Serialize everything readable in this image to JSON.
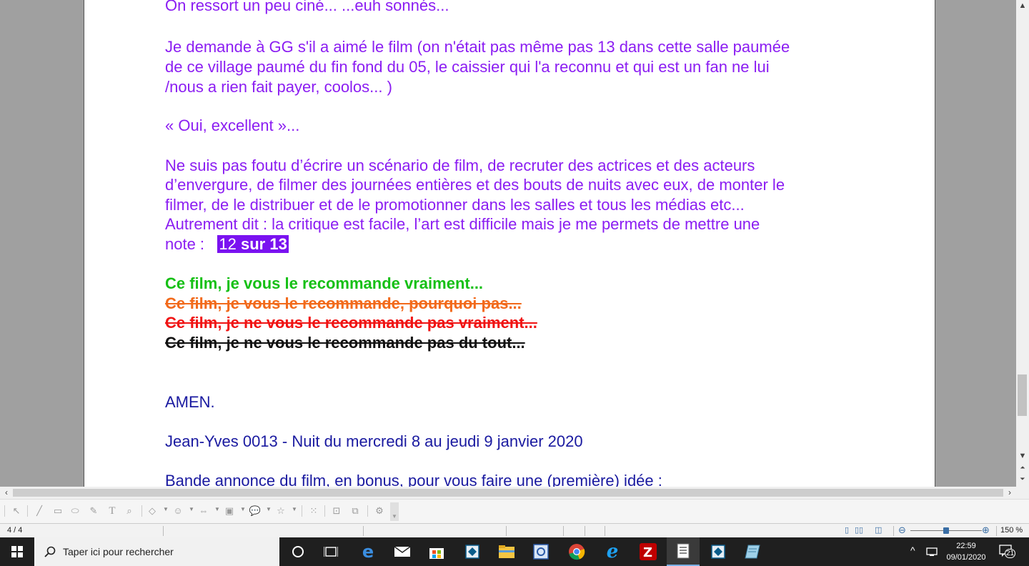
{
  "document": {
    "paragraphs": [
      "On ressort un peu ciné... ...euh sonnés...",
      "Je demande à GG s'il a aimé le film (on n'était pas même pas 13 dans cette salle paumée",
      "de ce village paumé du fin fond du 05, le caissier qui l'a reconnu et qui est un fan ne lui",
      "/nous a rien fait payer, coolos... )",
      "« Oui, excellent »...",
      "Ne suis pas foutu d’écrire un scénario de film, de recruter des actrices et des acteurs",
      "d’envergure, de filmer des journées entières et des bouts de nuits avec eux, de monter le",
      "filmer, de le distribuer et de le promotionner dans les salles et tous les médias etc...",
      "Autrement dit : la critique est facile, l’art est difficile mais je me permets de mettre une"
    ],
    "note_prefix": "note :",
    "note_value": "12",
    "note_rest": " sur 13",
    "recommendations": [
      "Ce film, je vous le recommande vraiment...",
      "Ce film, je vous le recommande, pourquoi  pas...",
      "Ce film, je ne vous le recommande pas vraiment...",
      "Ce film, je ne vous le recommande pas du tout..."
    ],
    "amen": "AMEN.",
    "signature": "Jean-Yves 0013  -  Nuit du mercredi 8 au jeudi 9 janvier 2020",
    "trailer": "Bande annonce du film, en bonus, pour vous faire une (première) idée  :"
  },
  "colors": {
    "violet_text": "#8b1df2",
    "navy_text": "#1a1aa0",
    "highlight": "#7a12f0",
    "green": "#16c016",
    "orange": "#f26a1b",
    "red": "#f01313"
  },
  "statusbar": {
    "page_indicator": "4 / 4",
    "zoom_level": "150 %"
  },
  "taskbar": {
    "search_placeholder": "Taper ici pour rechercher",
    "time": "22:59",
    "date": "09/01/2020",
    "notification_count": "21",
    "apps": [
      "task-view-icon",
      "edge-icon",
      "mail-icon",
      "store-icon",
      "app-icon",
      "file-explorer-icon",
      "outlook-icon",
      "chrome-icon",
      "internet-explorer-icon",
      "filezilla-icon",
      "libreoffice-draw-icon",
      "app-icon-2",
      "notepad-icon"
    ]
  }
}
